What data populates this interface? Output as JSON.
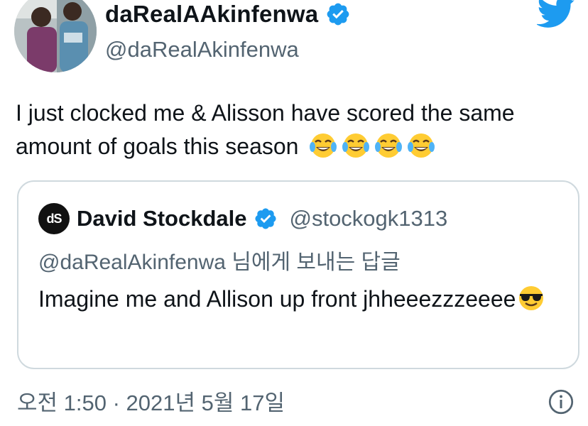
{
  "author": {
    "display_name": "daRealAAkinfenwa",
    "handle": "@daRealAkinfenwa",
    "verified": true
  },
  "tweet": {
    "text": "I just clocked me & Alisson have scored the same amount of goals this season",
    "emojis": [
      "face-with-tears-of-joy",
      "face-with-tears-of-joy",
      "face-with-tears-of-joy",
      "face-with-tears-of-joy"
    ]
  },
  "quoted_tweet": {
    "avatar_text": "dS",
    "display_name": "David Stockdale",
    "handle": "@stockogk1313",
    "verified": true,
    "reply_context": "@daRealAkinfenwa 님에게 보내는 답글",
    "text": "Imagine me and Allison up front jhheeezzzeeee",
    "emoji": "smiling-face-with-sunglasses"
  },
  "footer": {
    "timestamp": "오전 1:50 · 2021년 5월 17일"
  },
  "colors": {
    "twitter_blue": "#1d9bf0",
    "text_primary": "#0f1419",
    "text_secondary": "#536471",
    "border": "#cfd9de"
  }
}
